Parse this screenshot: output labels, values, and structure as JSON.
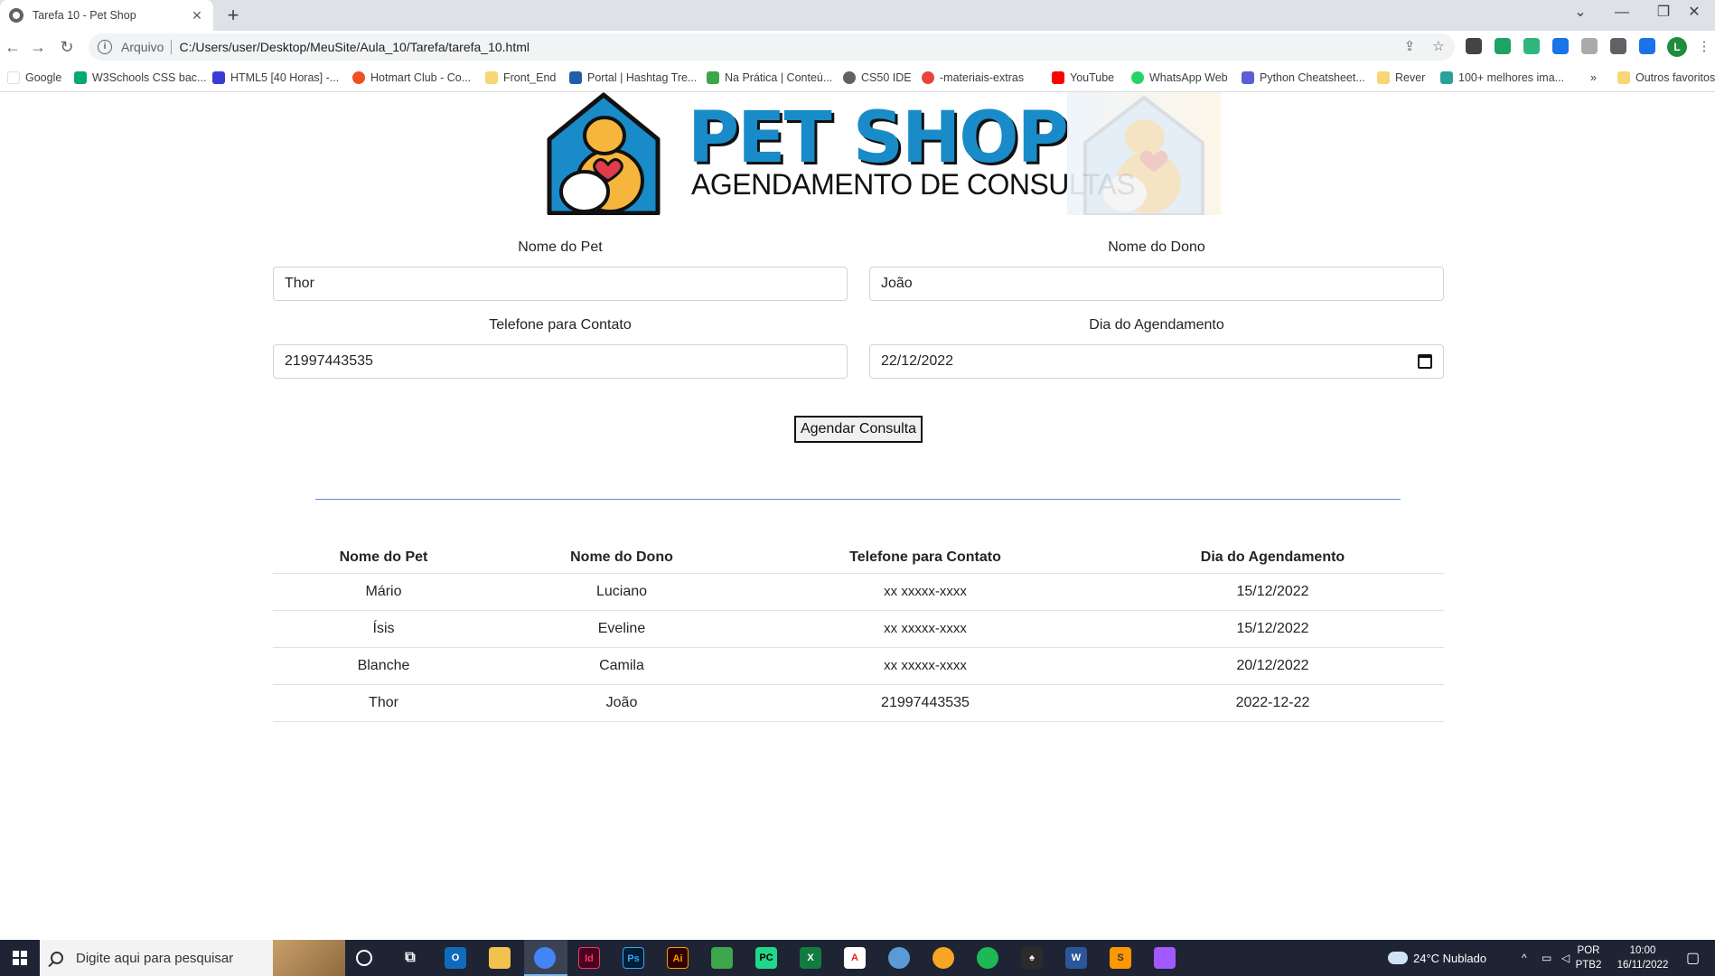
{
  "browser": {
    "tab_title": "Tarefa 10 - Pet Shop",
    "tab_close": "✕",
    "new_tab": "+",
    "scheme_label": "Arquivo",
    "url": "C:/Users/user/Desktop/MeuSite/Aula_10/Tarefa/tarefa_10.html",
    "profile_initial": "L",
    "bookmarks": [
      {
        "label": "Google",
        "color": "#ffffff"
      },
      {
        "label": "W3Schools CSS bac...",
        "color": "#04aa6d"
      },
      {
        "label": "HTML5 [40 Horas] -...",
        "color": "#3b3bd6"
      },
      {
        "label": "Hotmart Club - Co...",
        "color": "#f04e23"
      },
      {
        "label": "Front_End",
        "color": "#f7d774"
      },
      {
        "label": "Portal | Hashtag Tre...",
        "color": "#1f5fa8"
      },
      {
        "label": "Na Prática | Conteú...",
        "color": "#3da64a"
      },
      {
        "label": "CS50 IDE",
        "color": "#5f6368"
      },
      {
        "label": "-materiais-extras",
        "color": "#e8453c"
      },
      {
        "label": "YouTube",
        "color": "#ff0000"
      },
      {
        "label": "WhatsApp Web",
        "color": "#25d366"
      },
      {
        "label": "Python Cheatsheet...",
        "color": "#5a5fd6"
      },
      {
        "label": "Rever",
        "color": "#f7d774"
      },
      {
        "label": "100+ melhores ima...",
        "color": "#2aa198"
      }
    ],
    "bookmarks_overflow": "»",
    "other_bookmarks": "Outros favoritos"
  },
  "header": {
    "title": "PET SHOP",
    "subtitle": "AGENDAMENTO DE CONSULTAS"
  },
  "form": {
    "pet_label": "Nome do Pet",
    "pet_value": "Thor",
    "owner_label": "Nome do Dono",
    "owner_value": "João",
    "phone_label": "Telefone para Contato",
    "phone_value": "21997443535",
    "date_label": "Dia do Agendamento",
    "date_value": "22/12/2022",
    "submit_label": "Agendar Consulta"
  },
  "table": {
    "headers": [
      "Nome do Pet",
      "Nome do Dono",
      "Telefone para Contato",
      "Dia do Agendamento"
    ],
    "rows": [
      [
        "Mário",
        "Luciano",
        "xx xxxxx-xxxx",
        "15/12/2022"
      ],
      [
        "Ísis",
        "Eveline",
        "xx xxxxx-xxxx",
        "15/12/2022"
      ],
      [
        "Blanche",
        "Camila",
        "xx xxxxx-xxxx",
        "20/12/2022"
      ],
      [
        "Thor",
        "João",
        "21997443535",
        "2022-12-22"
      ]
    ]
  },
  "taskbar": {
    "search_placeholder": "Digite aqui para pesquisar",
    "weather": "24°C  Nublado",
    "lang_line1": "POR",
    "lang_line2": "PTB2",
    "time": "10:00",
    "date": "16/11/2022"
  },
  "colors": {
    "brand_blue": "#1a8bc9",
    "divider_blue": "#5b8def",
    "taskbar_bg": "#1e2433"
  }
}
